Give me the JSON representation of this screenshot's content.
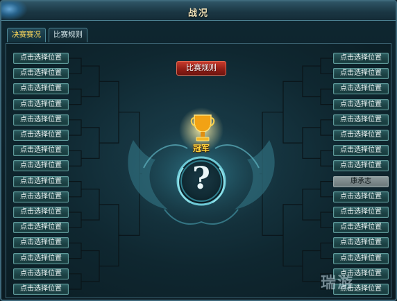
{
  "window": {
    "title": "战况"
  },
  "tabs": [
    {
      "label": "决赛赛况",
      "active": true
    },
    {
      "label": "比赛规则",
      "active": false
    }
  ],
  "rules_button": {
    "label": "比赛规则"
  },
  "champion": {
    "label": "冠军",
    "placeholder": "?"
  },
  "bracket": {
    "left_slots": [
      "点击选择位置",
      "点击选择位置",
      "点击选择位置",
      "点击选择位置",
      "点击选择位置",
      "点击选择位置",
      "点击选择位置",
      "点击选择位置",
      "点击选择位置",
      "点击选择位置",
      "点击选择位置",
      "点击选择位置",
      "点击选择位置",
      "点击选择位置",
      "点击选择位置",
      "点击选择位置"
    ],
    "right_slots": [
      "点击选择位置",
      "点击选择位置",
      "点击选择位置",
      "点击选择位置",
      "点击选择位置",
      "点击选择位置",
      "点击选择位置",
      "点击选择位置",
      "康承志",
      "点击选择位置",
      "点击选择位置",
      "点击选择位置",
      "点击选择位置",
      "点击选择位置",
      "点击选择位置",
      "点击选择位置"
    ],
    "right_taken_index": 8
  },
  "watermark": {
    "text": "瑞游"
  },
  "colors": {
    "accent": "#ffd95a",
    "slot": "#1d4346",
    "rules_button": "#8e1d15",
    "champion_text": "#ffd23c"
  }
}
